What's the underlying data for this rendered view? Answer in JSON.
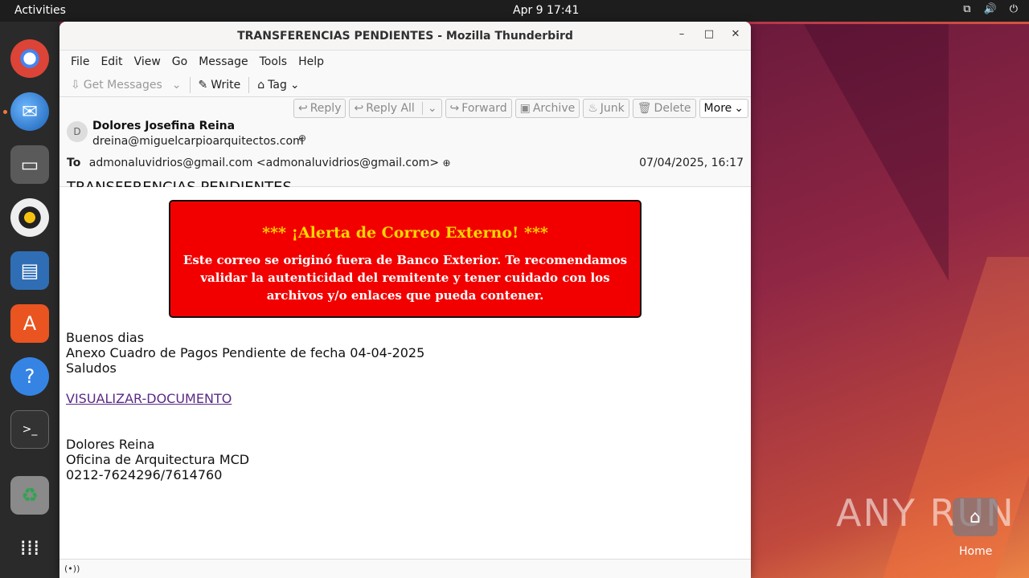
{
  "topbar": {
    "activities": "Activities",
    "clock": "Apr 9  17:41"
  },
  "window": {
    "title": "TRANSFERENCIAS PENDIENTES - Mozilla Thunderbird",
    "controls": {
      "minimize": "–",
      "maximize": "□",
      "close": "✕"
    }
  },
  "menubar": {
    "items": [
      "File",
      "Edit",
      "View",
      "Go",
      "Message",
      "Tools",
      "Help"
    ]
  },
  "toolbar": {
    "get_messages": "Get Messages",
    "write": "Write",
    "tag": "Tag"
  },
  "actions": {
    "reply": "Reply",
    "reply_all": "Reply All",
    "forward": "Forward",
    "archive": "Archive",
    "junk": "Junk",
    "delete": "Delete",
    "more": "More"
  },
  "message": {
    "avatar_letter": "D",
    "sender_name": "Dolores Josefina Reina",
    "sender_email": "dreina@miguelcarpioarquitectos.com",
    "to_label": "To",
    "to_value": "admonaluvidrios@gmail.com <admonaluvidrios@gmail.com>",
    "date": "07/04/2025, 16:17",
    "subject": "TRANSFERENCIAS PENDIENTES"
  },
  "alert": {
    "title": "*** ¡Alerta de Correo Externo! ***",
    "text": "Este correo se originó fuera de Banco Exterior. Te recomendamos validar la autenticidad del remitente y tener cuidado con los archivos y/o enlaces que pueda contener."
  },
  "body": {
    "greeting": "Buenos dias",
    "line1": "Anexo Cuadro de Pagos Pendiente de fecha 04-04-2025",
    "line2": "Saludos",
    "link": "VISUALIZAR-DOCUMENTO",
    "sig_name": "Dolores Reina",
    "sig_office": "Oficina de Arquitectura MCD",
    "sig_phone": "0212-7624296/7614760"
  },
  "statusbar": {
    "icon": "(•))"
  },
  "desktop": {
    "home_label": "Home",
    "watermark": "ANY RUN"
  },
  "dock": {
    "items": [
      "chrome-icon",
      "thunderbird-icon",
      "files-icon",
      "rhythmbox-icon",
      "writer-icon",
      "app-center-icon",
      "help-icon",
      "terminal-icon",
      "trash-icon",
      "app-grid-icon"
    ]
  },
  "colors": {
    "alert_bg": "#f20000",
    "alert_title": "#ffd700",
    "link": "#5b2a86"
  }
}
